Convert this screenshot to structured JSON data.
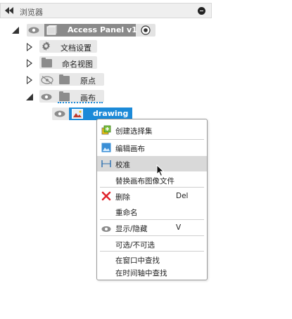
{
  "header": {
    "title": "浏览器"
  },
  "tree": {
    "root": {
      "label": "Access Panel v1"
    },
    "children": [
      {
        "label": "文档设置",
        "icon": "gear-icon"
      },
      {
        "label": "命名视图",
        "icon": "folder-icon"
      },
      {
        "label": "原点",
        "icon": "folder-icon",
        "visibility": "hidden"
      },
      {
        "label": "画布",
        "icon": "folder-icon",
        "expanded": true
      }
    ],
    "canvas_item": {
      "label": "drawing"
    }
  },
  "context_menu": {
    "items": [
      {
        "label": "创建选择集",
        "icon": "create-selection-set-icon"
      },
      {
        "label": "编辑画布",
        "icon": "edit-canvas-icon"
      },
      {
        "label": "校准",
        "icon": "calibrate-icon",
        "hovered": true
      },
      {
        "label": "替换画布图像文件"
      },
      {
        "label": "删除",
        "icon": "delete-icon",
        "shortcut": "Del"
      },
      {
        "label": "重命名"
      },
      {
        "label": "显示/隐藏",
        "icon": "eye-icon",
        "shortcut": "V"
      },
      {
        "label": "可选/不可选"
      },
      {
        "label": "在窗口中查找"
      },
      {
        "label": "在时间轴中查找"
      }
    ]
  },
  "colors": {
    "selection": "#1c8ad8",
    "hover": "#d9d9d9",
    "delete": "#e0262e"
  }
}
